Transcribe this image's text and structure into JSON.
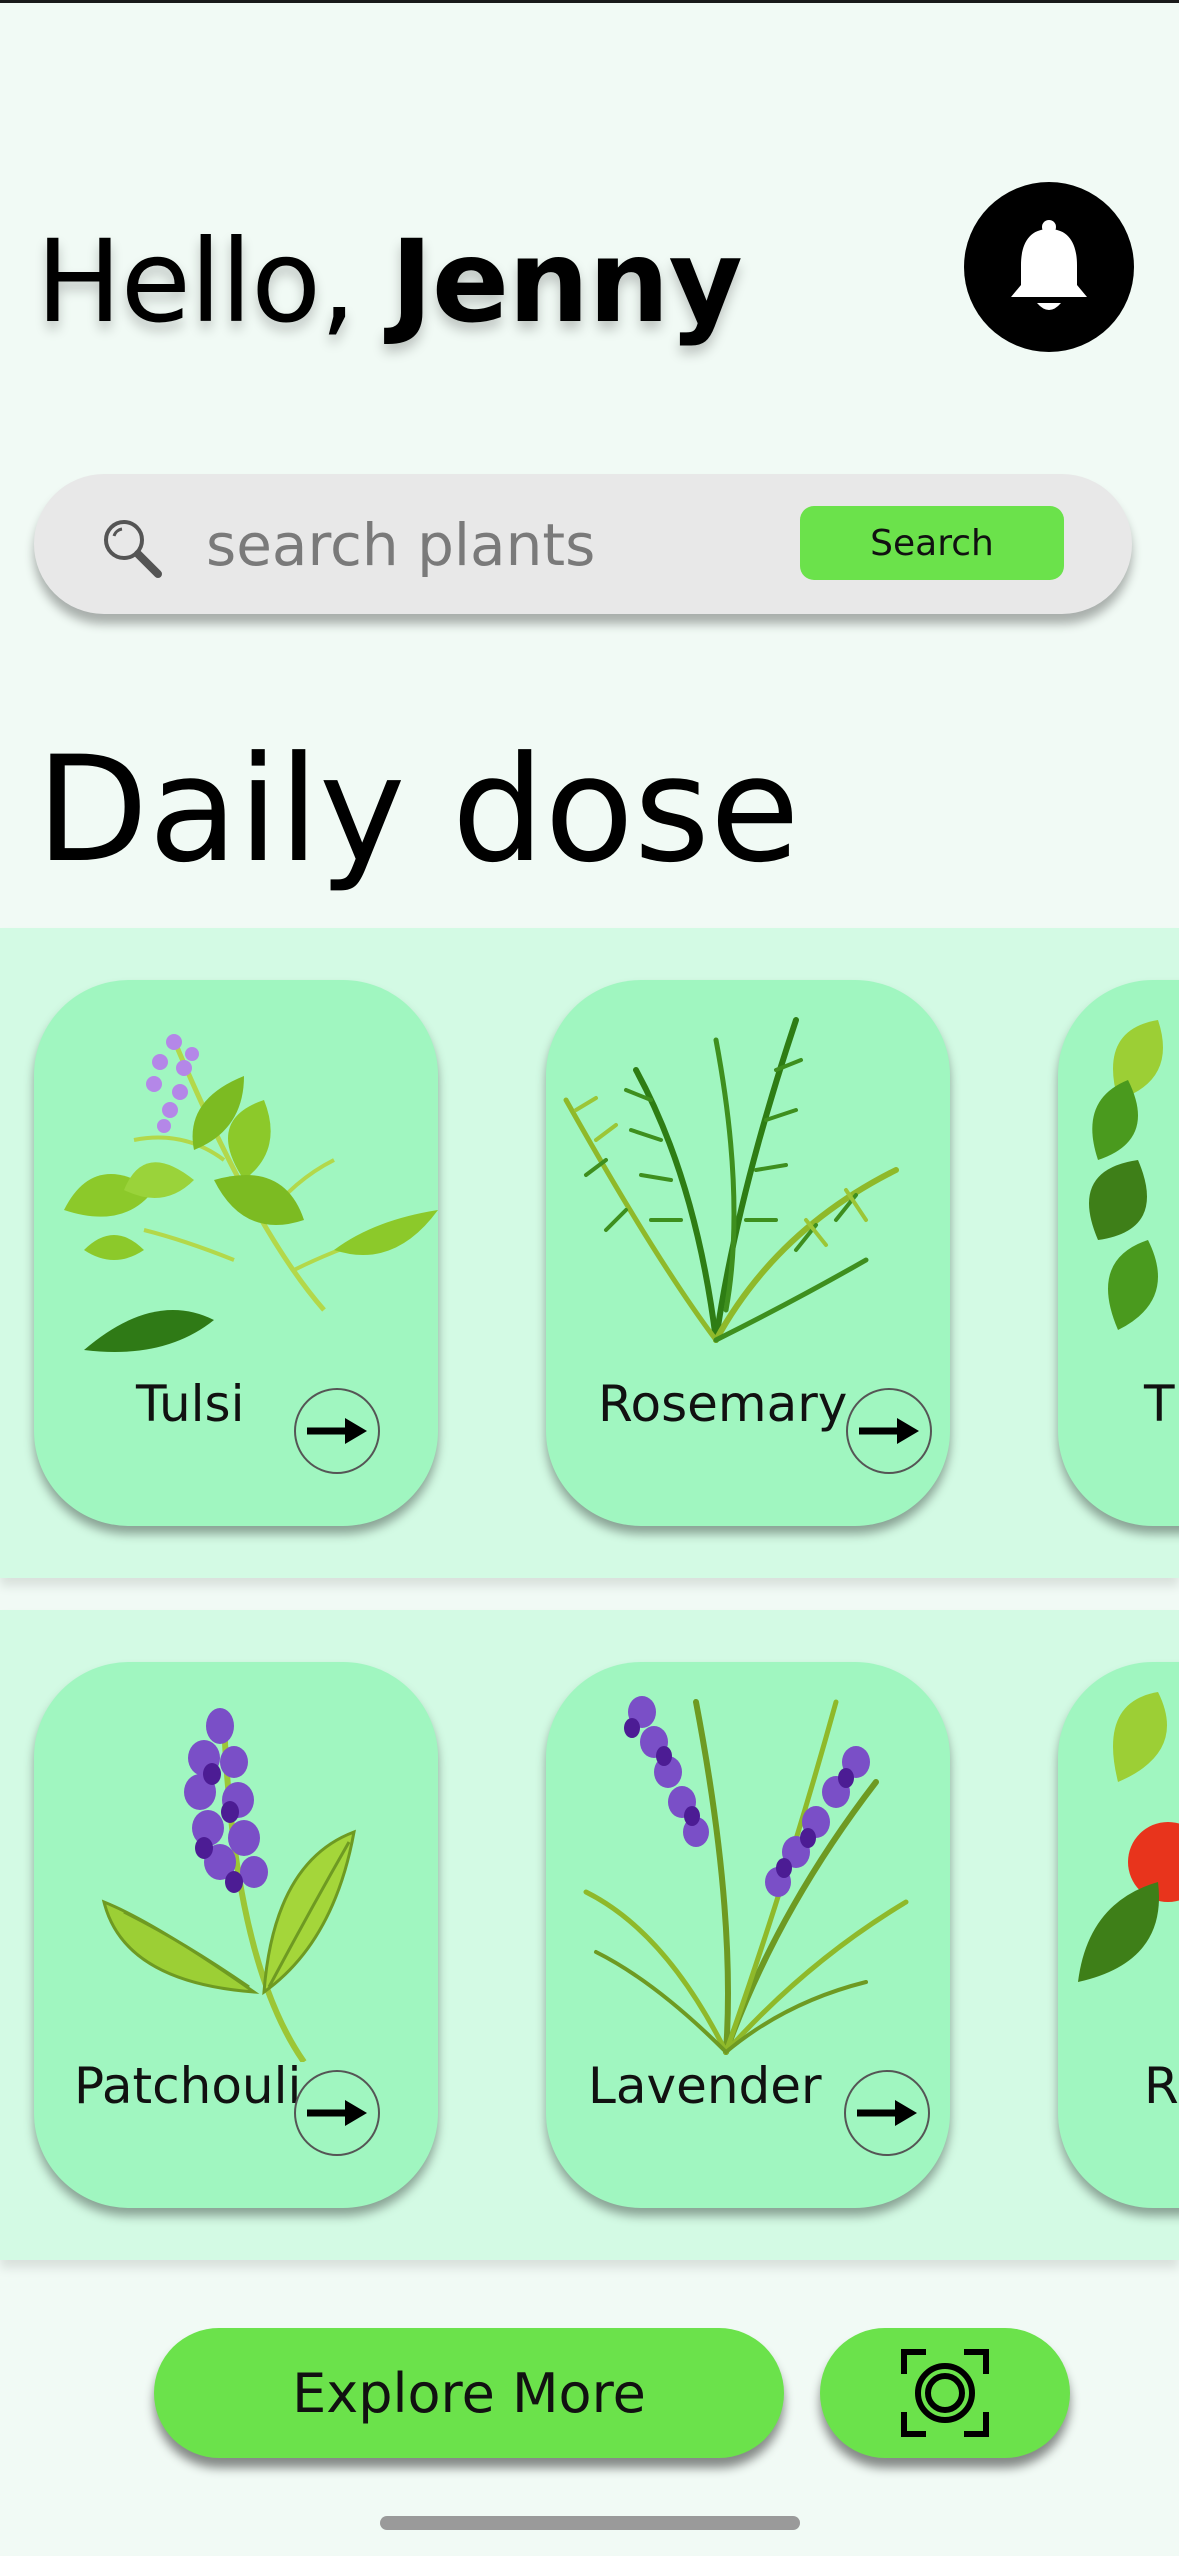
{
  "header": {
    "greeting_prefix": "Hello, ",
    "user_name": "Jenny",
    "notification_icon": "bell-icon"
  },
  "search": {
    "placeholder": "search plants",
    "value": "",
    "button_label": "Search",
    "icon": "search-icon"
  },
  "section": {
    "title": "Daily dose"
  },
  "rows": [
    {
      "cards": [
        {
          "label": "Tulsi",
          "icon": "tulsi-plant"
        },
        {
          "label": "Rosemary",
          "icon": "rosemary-plant"
        },
        {
          "label": "Th",
          "icon": "thyme-plant"
        }
      ]
    },
    {
      "cards": [
        {
          "label": "Patchouli",
          "icon": "patchouli-plant"
        },
        {
          "label": "Lavender",
          "icon": "lavender-plant"
        },
        {
          "label": "R",
          "icon": "red-berry-plant"
        }
      ]
    }
  ],
  "footer": {
    "explore_label": "Explore More",
    "scan_icon": "scan-icon"
  },
  "colors": {
    "background": "#f1faf5",
    "band": "#d3fae4",
    "card": "#a0f6c0",
    "accent_green": "#6be24b"
  }
}
